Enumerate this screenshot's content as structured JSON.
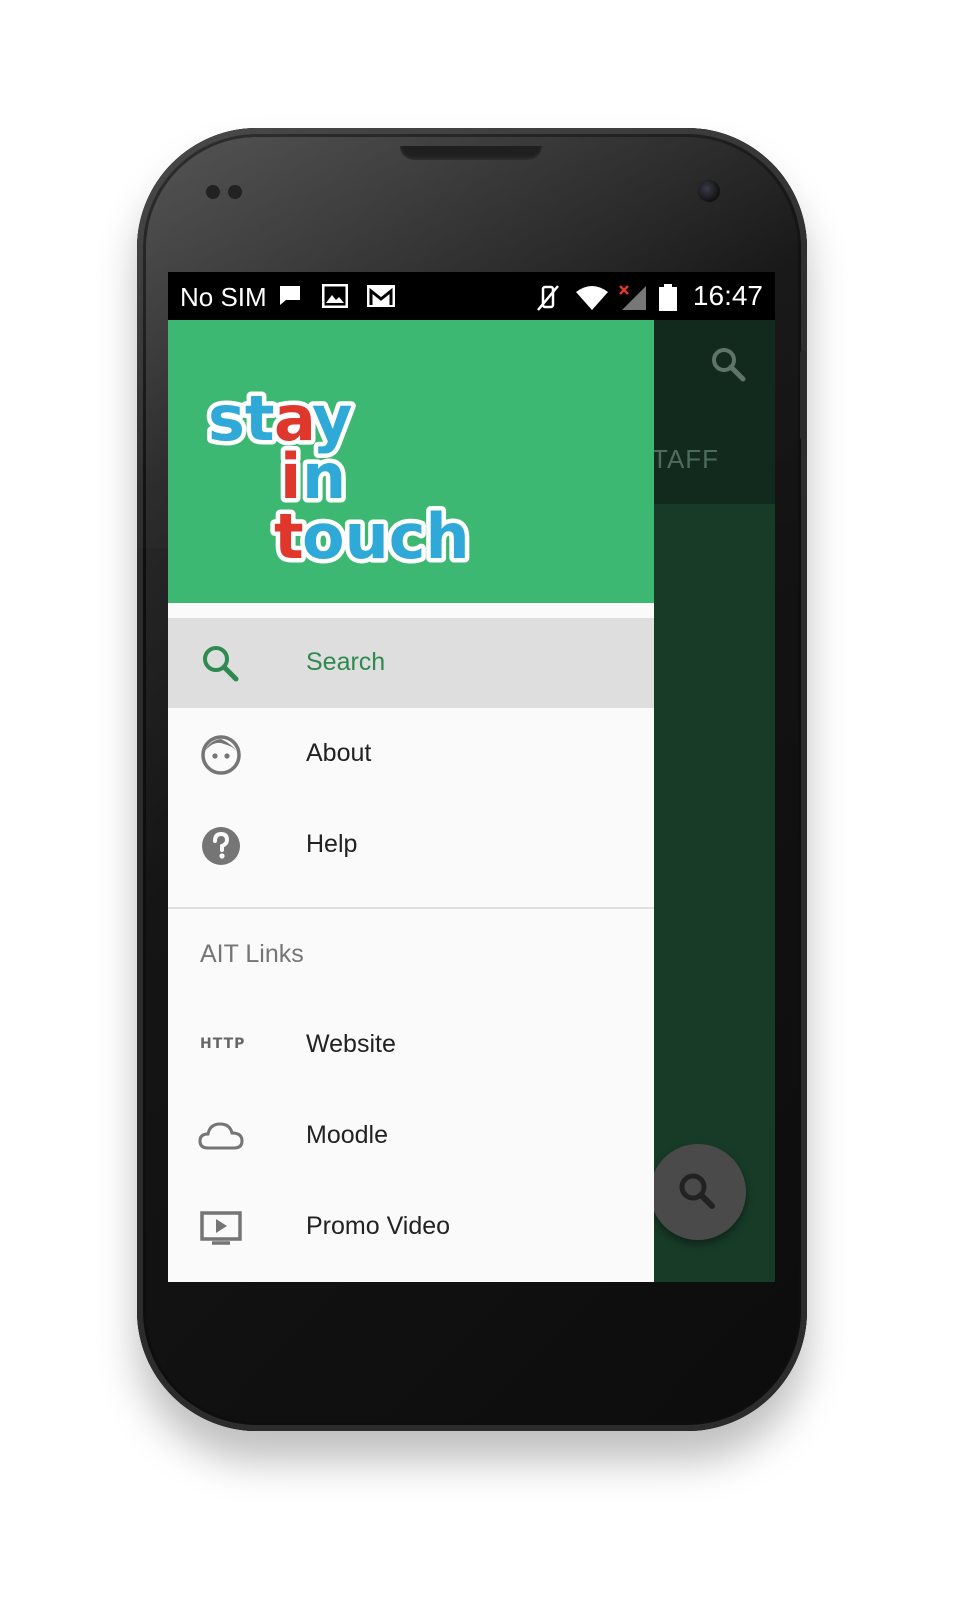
{
  "status_bar": {
    "carrier": "No SIM",
    "time": "16:47"
  },
  "app_behind": {
    "tab_label": "TAFF"
  },
  "drawer": {
    "logo_text": {
      "word1": "stay",
      "word2": "in",
      "word3": "touch"
    },
    "items": [
      {
        "label": "Search",
        "icon": "search-icon",
        "active": true
      },
      {
        "label": "About",
        "icon": "face-icon",
        "active": false
      },
      {
        "label": "Help",
        "icon": "help-icon",
        "active": false
      }
    ],
    "section_title": "AIT Links",
    "links": [
      {
        "label": "Website",
        "icon": "http-icon",
        "icon_text": "HTTP"
      },
      {
        "label": "Moodle",
        "icon": "cloud-icon"
      },
      {
        "label": "Promo Video",
        "icon": "video-icon"
      }
    ]
  },
  "colors": {
    "drawer_header": "#3db872",
    "active_text": "#2e8a4f",
    "scrim_app": "#1b3f2c"
  }
}
